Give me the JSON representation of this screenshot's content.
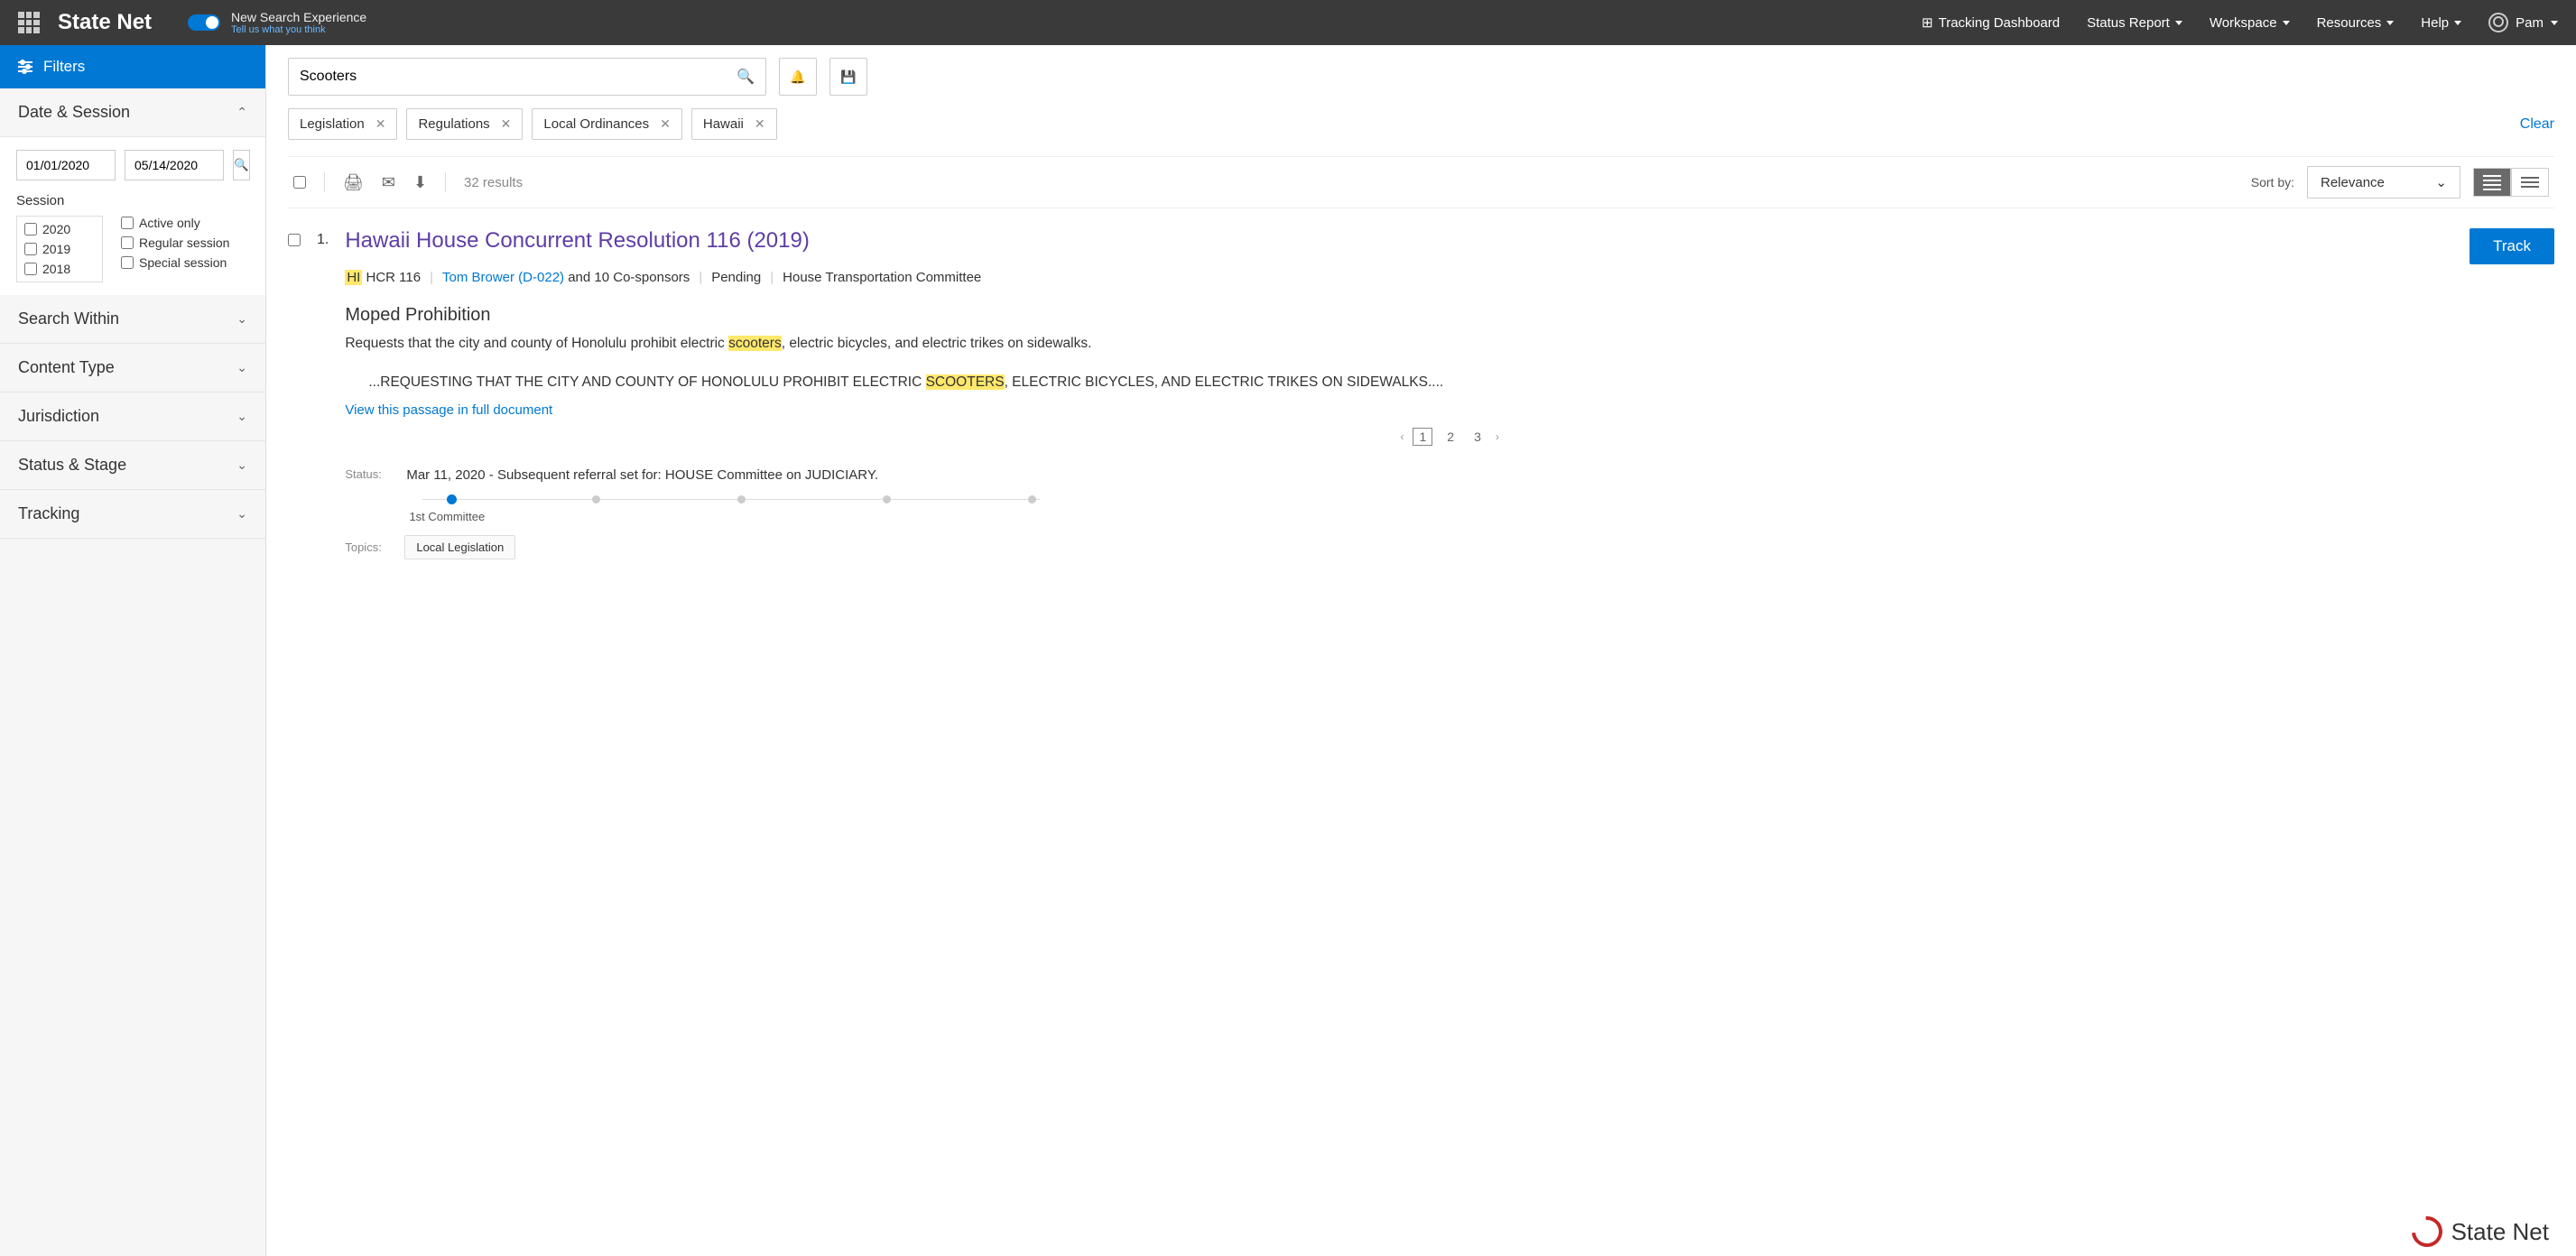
{
  "header": {
    "brand": "State Net",
    "toggle_title": "New Search Experience",
    "toggle_link": "Tell us what you think",
    "nav": {
      "tracking_dashboard": "Tracking Dashboard",
      "status_report": "Status Report",
      "workspace": "Workspace",
      "resources": "Resources",
      "help": "Help"
    },
    "user_name": "Pam"
  },
  "sidebar": {
    "filters_label": "Filters",
    "sections": {
      "date_session": "Date & Session",
      "search_within": "Search Within",
      "content_type": "Content Type",
      "jurisdiction": "Jurisdiction",
      "status_stage": "Status & Stage",
      "tracking": "Tracking"
    },
    "date_from": "01/01/2020",
    "date_to": "05/14/2020",
    "session_label": "Session",
    "sessions_years": [
      "2020",
      "2019",
      "2018"
    ],
    "sessions_types": [
      "Active only",
      "Regular session",
      "Special session"
    ]
  },
  "search": {
    "query": "Scooters",
    "chips": [
      "Legislation",
      "Regulations",
      "Local Ordinances",
      "Hawaii"
    ],
    "clear_label": "Clear",
    "results_count": "32 results",
    "sort_label": "Sort by:",
    "sort_value": "Relevance"
  },
  "result": {
    "index": "1.",
    "title": "Hawaii House Concurrent Resolution 116 (2019)",
    "track_btn": "Track",
    "meta": {
      "state": "HI",
      "id": " HCR 116",
      "sponsor_link": "Tom Brower (D-022)",
      "sponsor_rest": " and 10 Co-sponsors",
      "status": "Pending",
      "committee": "House Transportation Committee"
    },
    "subject": "Moped Prohibition",
    "snippet_pre": "Requests that the city and county of Honolulu prohibit electric ",
    "snippet_hl": "scooters",
    "snippet_post": ", electric bicycles, and electric trikes on sidewalks.",
    "excerpt_pre": "...REQUESTING THAT THE CITY AND COUNTY OF HONOLULU PROHIBIT ELECTRIC ",
    "excerpt_hl": "SCOOTERS",
    "excerpt_post": ", ELECTRIC BICYCLES, AND ELECTRIC TRIKES ON SIDEWALKS....",
    "view_passage": "View this passage in full document",
    "pager_pages": [
      "1",
      "2",
      "3"
    ],
    "status_label": "Status:",
    "status_text": "Mar 11, 2020 - Subsequent referral set for: HOUSE Committee on JUDICIARY.",
    "stage_label": "1st Committee",
    "topics_label": "Topics:",
    "topics": [
      "Local Legislation"
    ]
  },
  "footer": {
    "brand": "State Net"
  }
}
